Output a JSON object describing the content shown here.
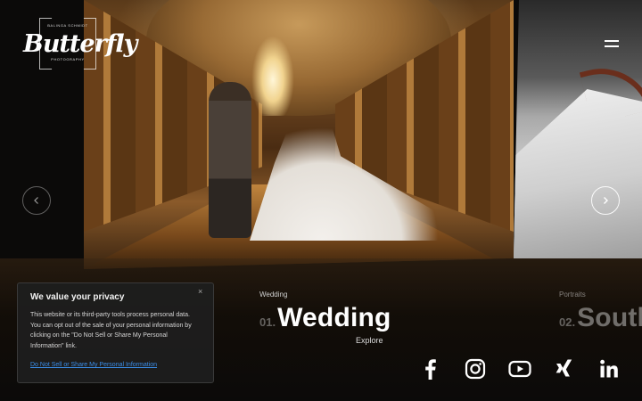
{
  "brand": {
    "logo_text": "Butterfly",
    "logo_top_line": "BALINGA SCHMIDT",
    "logo_bottom_line": "PHOTOGRAPHY"
  },
  "slider": {
    "current": {
      "category": "Wedding",
      "number": "01.",
      "title": "Wedding",
      "explore_label": "Explore"
    },
    "next": {
      "category": "Portraits",
      "number": "02.",
      "title": "South"
    }
  },
  "social": [
    {
      "name": "facebook-icon"
    },
    {
      "name": "instagram-icon"
    },
    {
      "name": "youtube-icon"
    },
    {
      "name": "xing-icon"
    },
    {
      "name": "linkedin-icon"
    }
  ],
  "cookie": {
    "title": "We value your privacy",
    "body": "This website or its third-party tools process personal data. You can opt out of the sale of your personal information by clicking on the \"Do Not Sell or Share My Personal Information\" link.",
    "link": "Do Not Sell or Share My Personal Information",
    "close": "×"
  },
  "colors": {
    "background": "#0b0a09",
    "link": "#3b8ee8",
    "banner": "#1e1e1e"
  }
}
